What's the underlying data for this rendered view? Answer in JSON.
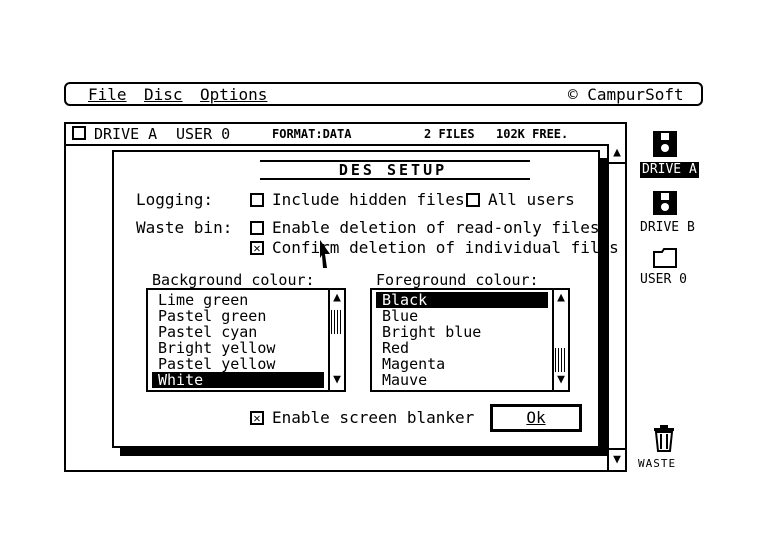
{
  "menubar": {
    "items": [
      {
        "label": "File"
      },
      {
        "label": "Disc"
      },
      {
        "label": "Options"
      }
    ],
    "brand": "© CampurSoft"
  },
  "file_window": {
    "drive": "DRIVE A",
    "user": "USER 0",
    "format": "FORMAT:DATA",
    "files": "2 FILES",
    "free": "102K FREE."
  },
  "dialog": {
    "title": "DES  SETUP",
    "logging_label": "Logging:",
    "include_hidden": {
      "label": "Include hidden files",
      "checked": false
    },
    "all_users": {
      "label": "All users",
      "checked": false
    },
    "waste_label": "Waste bin:",
    "enable_readonly": {
      "label": "Enable deletion of read-only files",
      "checked": false
    },
    "confirm_individual": {
      "label": "Confirm deletion of individual files",
      "checked": true
    },
    "background": {
      "label": "Background colour:",
      "items": [
        "Lime green",
        "Pastel green",
        "Pastel cyan",
        "Bright yellow",
        "Pastel yellow",
        "White"
      ],
      "selected": "White"
    },
    "foreground": {
      "label": "Foreground colour:",
      "items": [
        "Black",
        "Blue",
        "Bright blue",
        "Red",
        "Magenta",
        "Mauve"
      ],
      "selected": "Black"
    },
    "screen_blanker": {
      "label": "Enable screen blanker",
      "checked": true
    },
    "ok_label": "Ok"
  },
  "desktop": {
    "drive_a": "DRIVE A",
    "drive_b": "DRIVE B",
    "user_0": "USER 0",
    "waste": "WASTE"
  },
  "colors": {
    "foreground": "#000000",
    "background": "#ffffff"
  }
}
